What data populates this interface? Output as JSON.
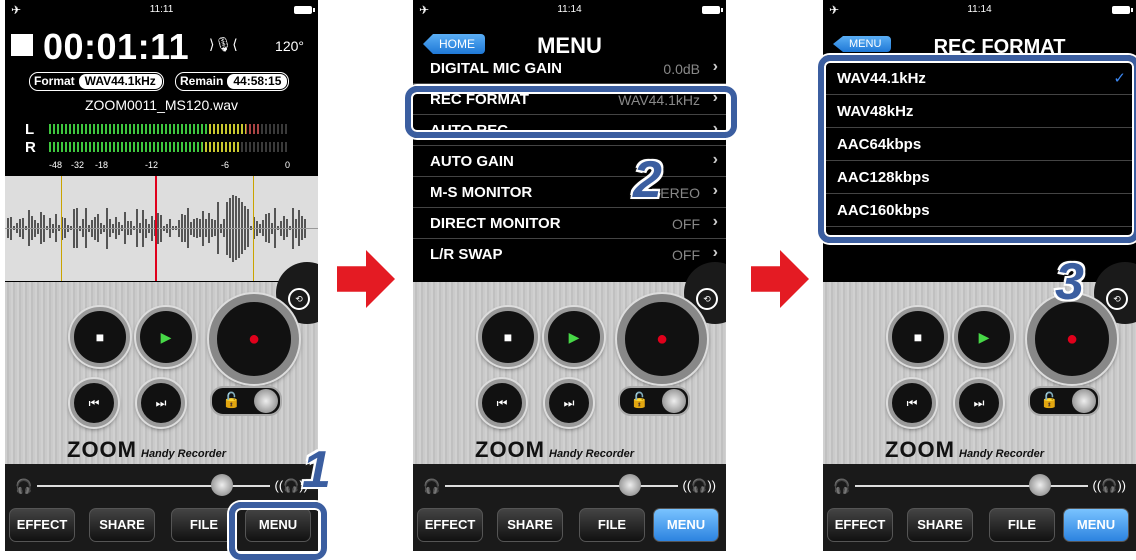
{
  "colors": {
    "accent_blue": "#2c83e0",
    "callout": "#3b5ea0",
    "arrow": "#e41b23",
    "record_red": "#e0001b",
    "play_green": "#47d847"
  },
  "panel1": {
    "status_time": "11:11",
    "timer": "00:01:11",
    "angle": "120°",
    "format_key": "Format",
    "format_value": "WAV44.1kHz",
    "remain_key": "Remain",
    "remain_value": "44:58:15",
    "filename": "ZOOM0011_MS120.wav",
    "meter_left": "L",
    "meter_right": "R",
    "meter_scale": [
      "-48",
      "-32",
      "-18",
      "-12",
      "-6",
      "0"
    ]
  },
  "panel2": {
    "status_time": "11:14",
    "back_label": "HOME",
    "title": "MENU",
    "rows": [
      {
        "label": "DIGITAL MIC GAIN",
        "value": "0.0dB"
      },
      {
        "label": "REC FORMAT",
        "value": "WAV44.1kHz"
      },
      {
        "label": "AUTO REC",
        "value": ""
      },
      {
        "label": "AUTO GAIN",
        "value": ""
      },
      {
        "label": "M-S MONITOR",
        "value": "STEREO"
      },
      {
        "label": "DIRECT MONITOR",
        "value": "OFF"
      },
      {
        "label": "L/R SWAP",
        "value": "OFF"
      }
    ]
  },
  "panel3": {
    "status_time": "11:14",
    "back_label": "MENU",
    "title": "REC FORMAT",
    "options": [
      "WAV44.1kHz",
      "WAV48kHz",
      "AAC64kbps",
      "AAC128kbps",
      "AAC160kbps"
    ],
    "selected": "WAV44.1kHz",
    "check": "✓"
  },
  "console": {
    "brand": "ZOOM",
    "brand_sub": "Handy Recorder",
    "tabs": [
      "EFFECT",
      "SHARE",
      "FILE",
      "MENU"
    ]
  },
  "callouts": [
    "1",
    "2",
    "3"
  ]
}
